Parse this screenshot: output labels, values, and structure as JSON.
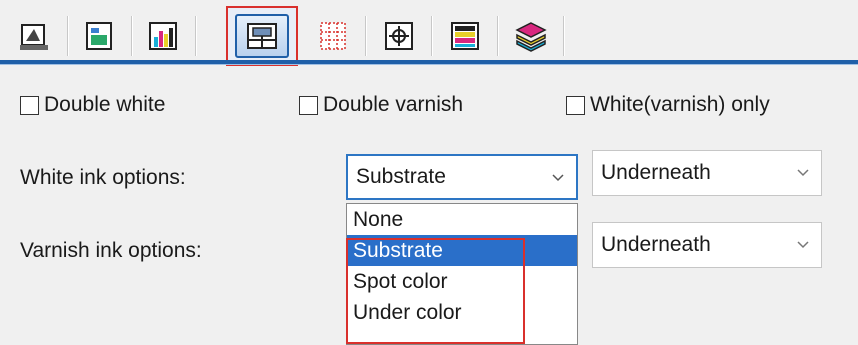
{
  "toolbar": {
    "tabs": [
      {
        "icon": "print-settings-icon"
      },
      {
        "icon": "color-management-icon"
      },
      {
        "icon": "ink-levels-icon"
      },
      {
        "icon": "white-ink-layout-icon"
      },
      {
        "icon": "grid-layout-icon"
      },
      {
        "icon": "crop-mark-icon"
      },
      {
        "icon": "layer-stack-icon"
      },
      {
        "icon": "layers-icon"
      }
    ],
    "selected_index": 3
  },
  "options": {
    "double_white": "Double white",
    "double_varnish": "Double varnish",
    "white_varnish_only": "White(varnish) only"
  },
  "white_ink": {
    "label": "White ink options:",
    "source_value": "Substrate",
    "position_value": "Underneath"
  },
  "varnish_ink": {
    "label": "Varnish ink options:",
    "position_value": "Underneath"
  },
  "dropdown_list": {
    "items": [
      "None",
      "Substrate",
      "Spot color",
      "Under color"
    ],
    "selected": "Substrate"
  },
  "colors": {
    "accent_blue": "#1f5fa8",
    "selection": "#2a6fc9",
    "highlight_red": "#d9302c"
  }
}
